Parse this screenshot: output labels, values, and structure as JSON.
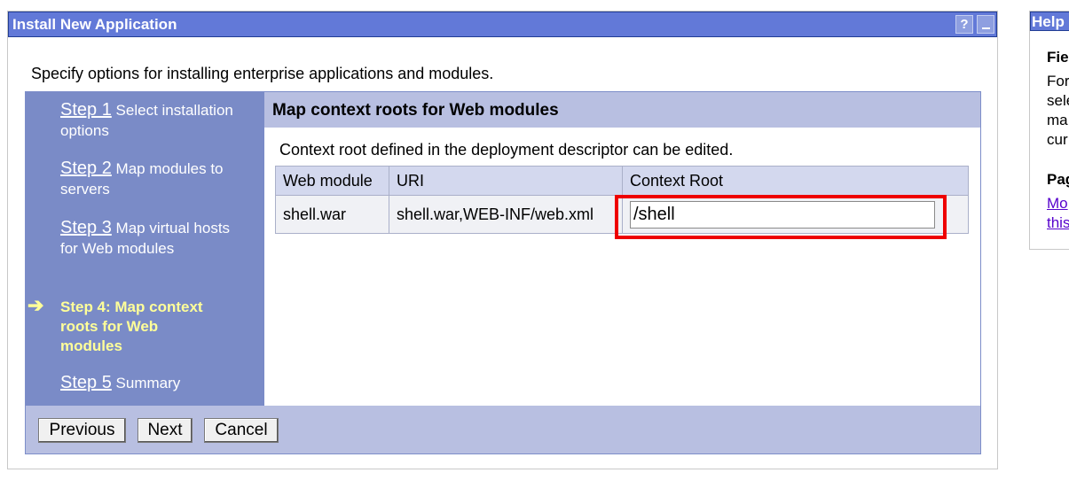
{
  "window": {
    "title": "Install New Application",
    "help_glyph": "?"
  },
  "intro": "Specify options for installing enterprise applications and modules.",
  "steps": [
    {
      "link": "Step 1",
      "text": " Select installation options"
    },
    {
      "link": "Step 2",
      "text": " Map modules to servers"
    },
    {
      "link": "Step 3",
      "text": " Map virtual hosts for Web modules"
    },
    {
      "current": "Step 4: Map context roots for Web modules"
    },
    {
      "link": "Step 5",
      "text": " Summary"
    }
  ],
  "current_arrow": "➔",
  "content": {
    "title": "Map context roots for Web modules",
    "description": "Context root defined in the deployment descriptor can be edited.",
    "columns": [
      "Web module",
      "URI",
      "Context Root"
    ],
    "rows": [
      {
        "module": "shell.war",
        "uri": "shell.war,WEB-INF/web.xml",
        "context_root": "/shell"
      }
    ]
  },
  "buttons": {
    "previous": "Previous",
    "next": "Next",
    "cancel": "Cancel"
  },
  "help": {
    "title": "Help",
    "field_heading": "Fie",
    "field_text": [
      "For",
      "sele",
      "ma",
      "cur"
    ],
    "page_heading": "Pag",
    "page_links": [
      "Mo",
      "this"
    ]
  },
  "colors": {
    "titlebar": "#6279d8",
    "steps_bg": "#7a8bc7",
    "current_step": "#ffff99",
    "highlight": "#ee0000"
  }
}
